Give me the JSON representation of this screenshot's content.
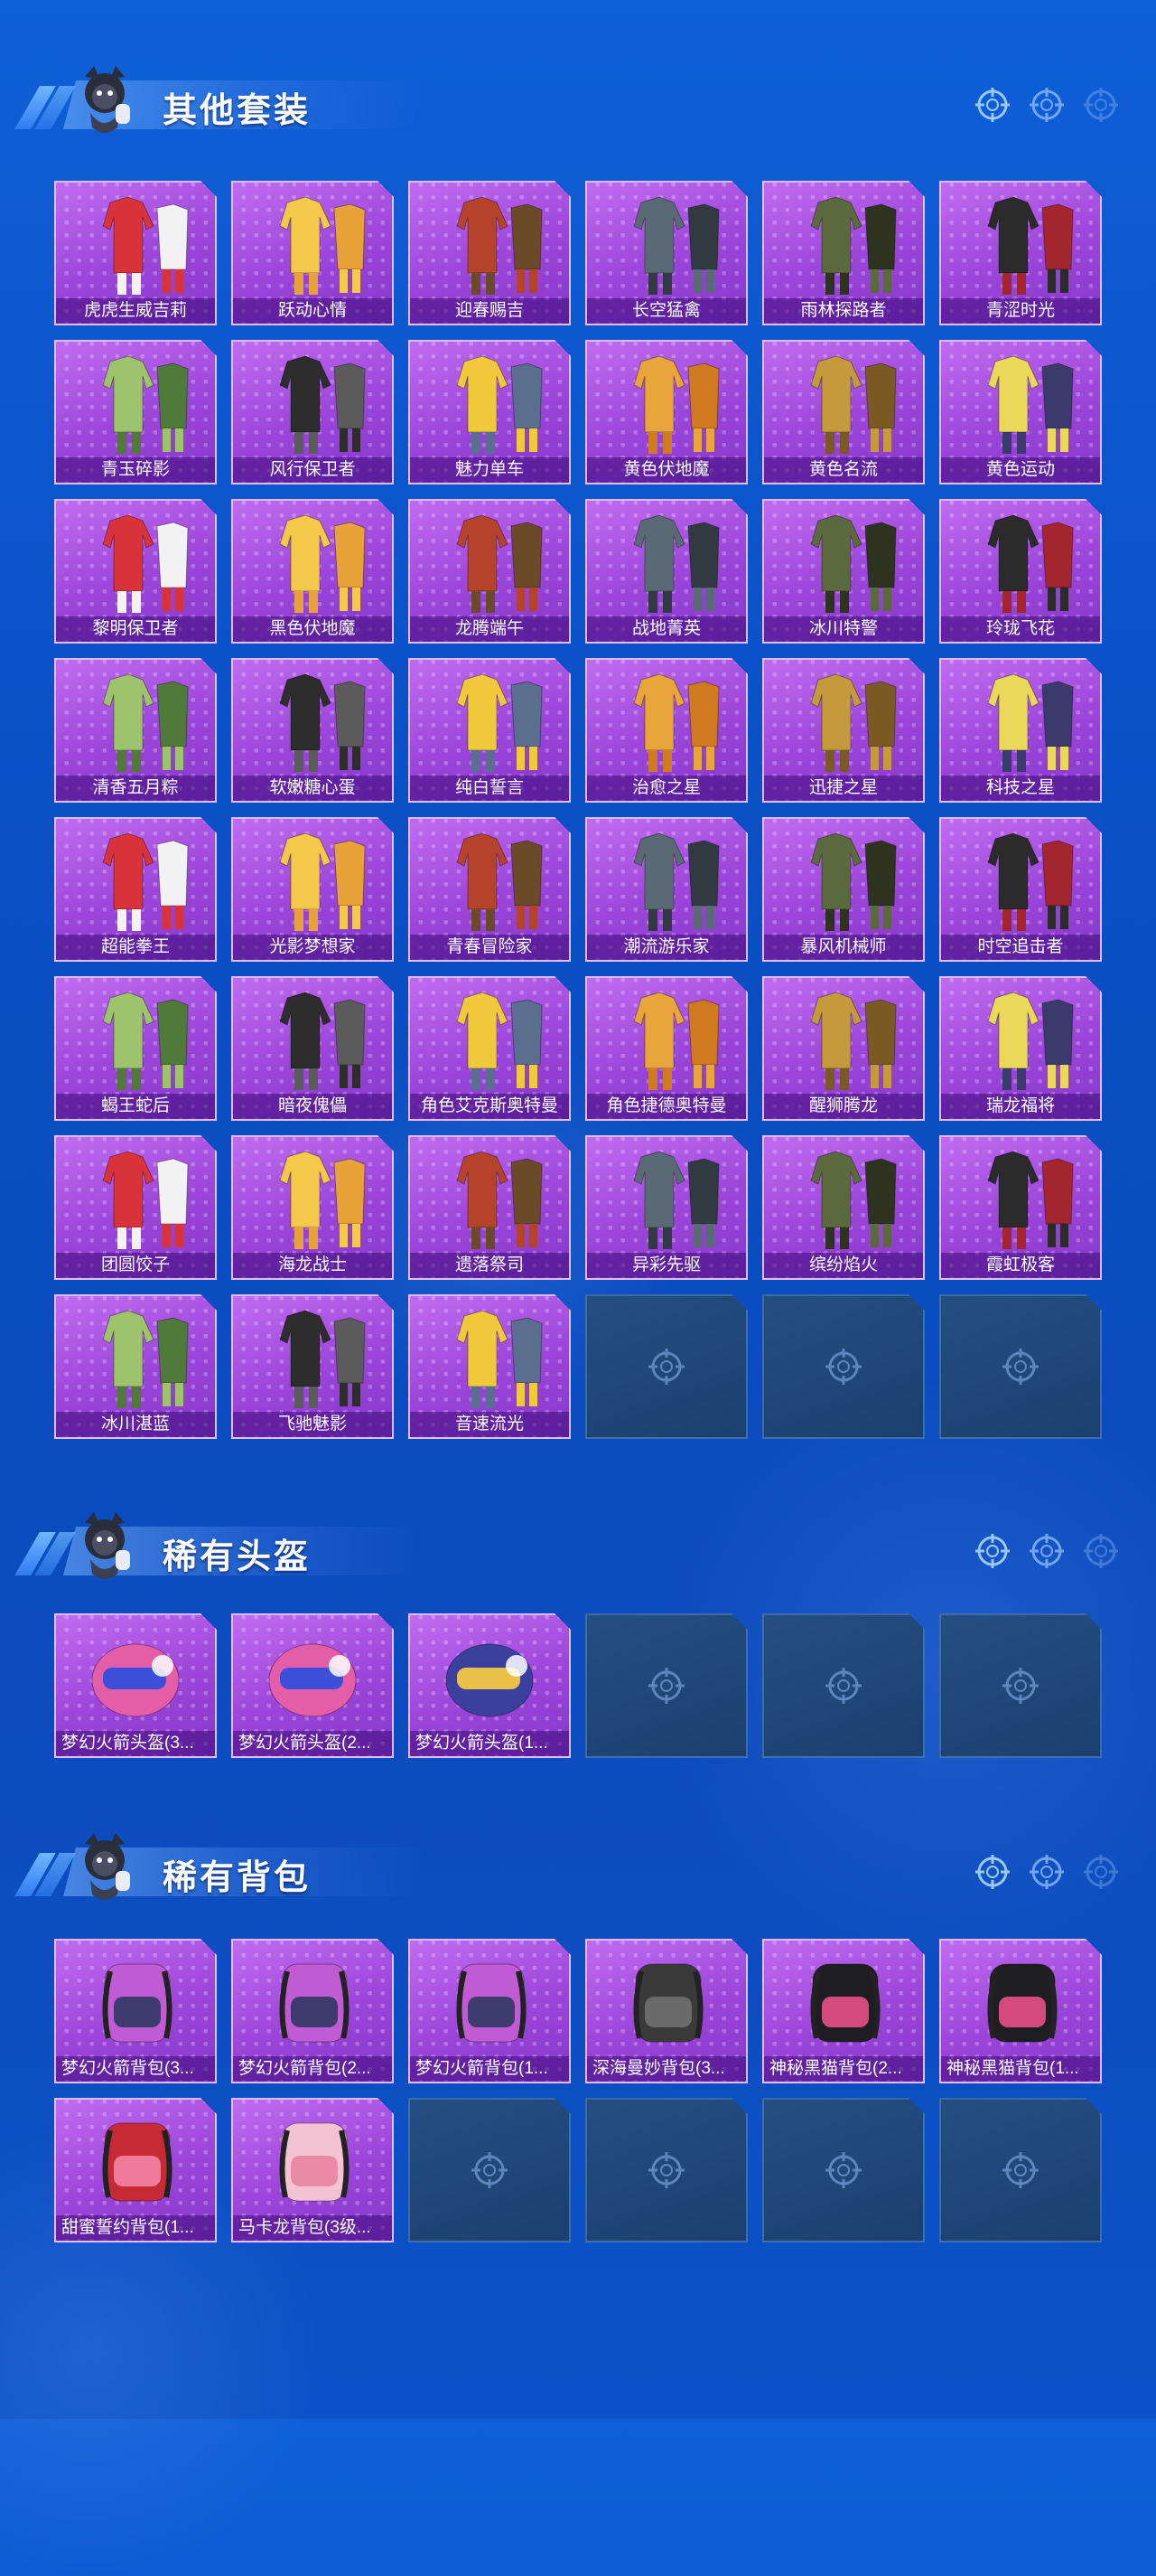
{
  "colors": {
    "background": "#0b4fc4",
    "item_card": "#9b45d9",
    "empty_card": "#1f4677",
    "label_bg": "#3c0a78",
    "text": "#ffffff"
  },
  "sections": {
    "outfits": {
      "title": "其他套装",
      "items": [
        "虎虎生威吉莉",
        "跃动心情",
        "迎春赐吉",
        "长空猛禽",
        "雨林探路者",
        "青涩时光",
        "青玉碎影",
        "风行保卫者",
        "魅力单车",
        "黄色伏地魔",
        "黄色名流",
        "黄色运动",
        "黎明保卫者",
        "黑色伏地魔",
        "龙腾端午",
        "战地菁英",
        "冰川特警",
        "玲珑飞花",
        "清香五月粽",
        "软嫩糖心蛋",
        "纯白誓言",
        "治愈之星",
        "迅捷之星",
        "科技之星",
        "超能拳王",
        "光影梦想家",
        "青春冒险家",
        "潮流游乐家",
        "暴风机械师",
        "时空追击者",
        "蝎王蛇后",
        "暗夜傀儡",
        "角色艾克斯奥特曼",
        "角色捷德奥特曼",
        "醒狮腾龙",
        "瑞龙福将",
        "团圆饺子",
        "海龙战士",
        "遗落祭司",
        "异彩先驱",
        "缤纷焰火",
        "霞虹极客",
        "冰川湛蓝",
        "飞驰魅影",
        "音速流光"
      ],
      "empty_slots": 3
    },
    "helmets": {
      "title": "稀有头盔",
      "items": [
        "梦幻火箭头盔(3...",
        "梦幻火箭头盔(2...",
        "梦幻火箭头盔(1..."
      ],
      "empty_slots": 3
    },
    "backpacks": {
      "title": "稀有背包",
      "items": [
        "梦幻火箭背包(3...",
        "梦幻火箭背包(2...",
        "梦幻火箭背包(1...",
        "深海曼妙背包(3...",
        "神秘黑猫背包(2...",
        "神秘黑猫背包(1...",
        "甜蜜誓约背包(1...",
        "马卡龙背包(3级..."
      ],
      "empty_slots": 4
    }
  },
  "icons": {
    "section_mascot": "mascot-icon",
    "header_marks": "crosshair-icon",
    "empty_slot_mark": "crosshair-icon"
  }
}
